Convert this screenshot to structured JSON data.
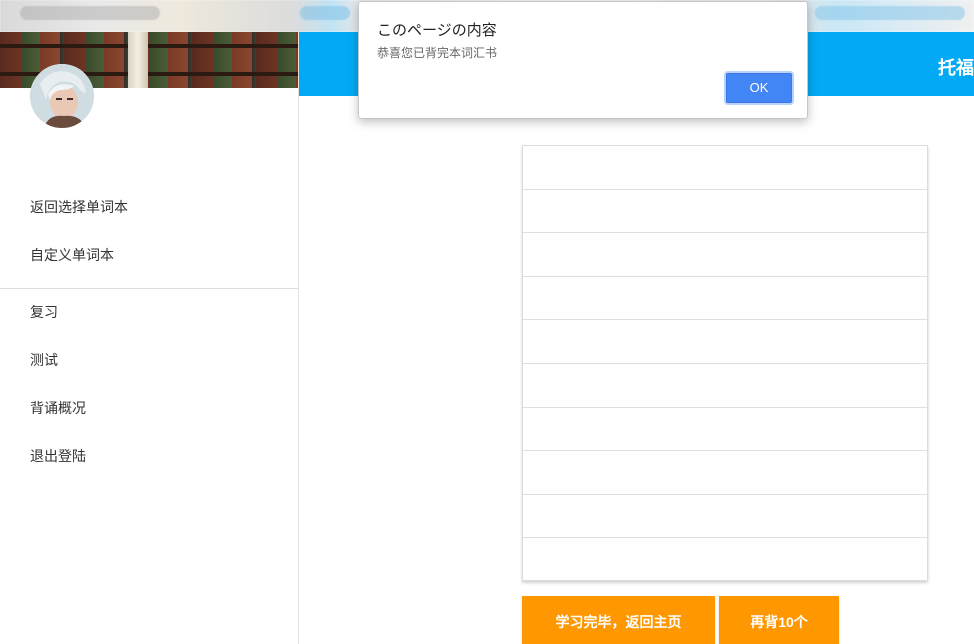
{
  "dialog": {
    "title": "このページの内容",
    "message": "恭喜您已背完本词汇书",
    "ok_label": "OK"
  },
  "header": {
    "title": "托福"
  },
  "sidebar": {
    "items": [
      {
        "label": "返回选择单词本"
      },
      {
        "label": "自定义单词本"
      },
      {
        "label": "复习"
      },
      {
        "label": "测试"
      },
      {
        "label": "背诵概况"
      },
      {
        "label": "退出登陆"
      }
    ]
  },
  "word_list": {
    "rows": [
      "",
      "",
      "",
      "",
      "",
      "",
      "",
      "",
      "",
      ""
    ]
  },
  "actions": {
    "finish_label": "学习完毕，返回主页",
    "again_label": "再背10个"
  },
  "colors": {
    "header": "#03a9f4",
    "action_button": "#ff9800",
    "dialog_ok": "#4285f4"
  }
}
